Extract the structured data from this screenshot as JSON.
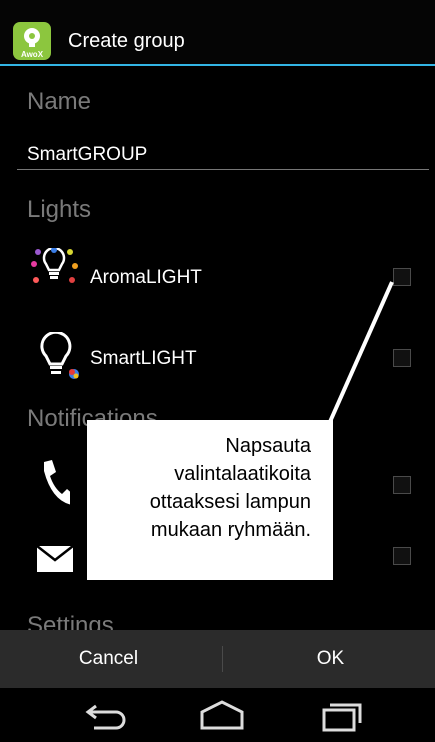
{
  "header": {
    "app_icon_brand": "AwoX",
    "title": "Create group"
  },
  "form": {
    "name_label": "Name",
    "name_value": "SmartGROUP",
    "lights_label": "Lights",
    "notifications_label": "Notifications",
    "settings_label": "Settings",
    "lights": [
      {
        "label": "AromaLIGHT",
        "icon": "aroma-light-bulb-icon",
        "checked": false
      },
      {
        "label": "SmartLIGHT",
        "icon": "smart-light-bulb-icon",
        "checked": false
      }
    ],
    "notifications": [
      {
        "icon": "phone-icon",
        "checked": false
      },
      {
        "icon": "envelope-icon",
        "checked": false
      }
    ]
  },
  "callout": {
    "lines": [
      "Napsauta",
      "valintalaatikoita",
      "ottaaksesi lampun",
      "mukaan ryhmään."
    ]
  },
  "actions": {
    "cancel_label": "Cancel",
    "ok_label": "OK"
  },
  "navbar": {
    "back": "back-icon",
    "home": "home-icon",
    "recents": "recent-apps-icon"
  },
  "colors": {
    "accent": "#33b5e5",
    "app_icon": "#8cc63e",
    "section_header": "#7a7a7a"
  }
}
